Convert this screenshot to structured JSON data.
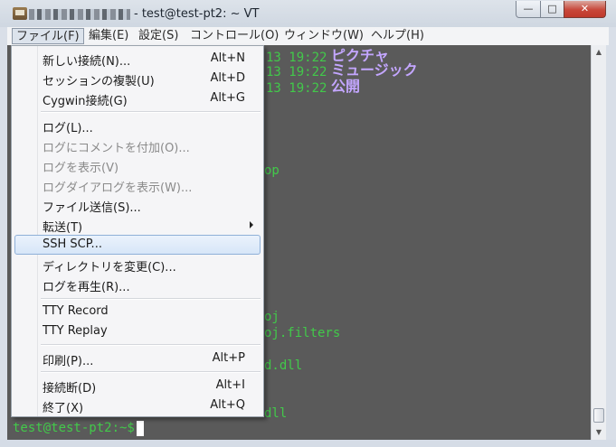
{
  "title": {
    "text": "- test@test-pt2: ~ VT"
  },
  "caption_buttons": {
    "minimize": "—",
    "maximize": "□",
    "close": "✕"
  },
  "menubar": {
    "items": [
      {
        "label": "ファイル(F)"
      },
      {
        "label": "編集(E)"
      },
      {
        "label": "設定(S)"
      },
      {
        "label": "コントロール(O)"
      },
      {
        "label": "ウィンドウ(W)"
      },
      {
        "label": "ヘルプ(H)"
      }
    ]
  },
  "file_menu": {
    "items": [
      {
        "label": "新しい接続(N)...",
        "shortcut": "Alt+N"
      },
      {
        "label": "セッションの複製(U)",
        "shortcut": "Alt+D"
      },
      {
        "label": "Cygwin接続(G)",
        "shortcut": "Alt+G"
      },
      {
        "label": "ログ(L)..."
      },
      {
        "label": "ログにコメントを付加(O)..."
      },
      {
        "label": "ログを表示(V)"
      },
      {
        "label": "ログダイアログを表示(W)..."
      },
      {
        "label": "ファイル送信(S)..."
      },
      {
        "label": "転送(T)"
      },
      {
        "label": "SSH SCP..."
      },
      {
        "label": "ディレクトリを変更(C)..."
      },
      {
        "label": "ログを再生(R)..."
      },
      {
        "label": "TTY Record"
      },
      {
        "label": "TTY Replay"
      },
      {
        "label": "印刷(P)...",
        "shortcut": "Alt+P"
      },
      {
        "label": "接続断(D)",
        "shortcut": "Alt+I"
      },
      {
        "label": "終了(X)",
        "shortcut": "Alt+Q"
      }
    ]
  },
  "terminal": {
    "lines": [
      {
        "date": "13 19:22",
        "name": "ピクチャ"
      },
      {
        "date": "13 19:22",
        "name": "ミュージック"
      },
      {
        "date": "13 19:22",
        "name": "公開"
      }
    ],
    "fragments": [
      "op",
      "oj",
      "oj.filters",
      "d.dll",
      "dll"
    ],
    "prompt": "test@test-pt2:~$",
    "colors": {
      "background": "#5a5a5a",
      "text": "#42c94a",
      "directory": "#c3a6ff",
      "cursor": "#ffffff"
    }
  },
  "scrollbar": {
    "up_arrow": "▲",
    "down_arrow": "▼"
  }
}
